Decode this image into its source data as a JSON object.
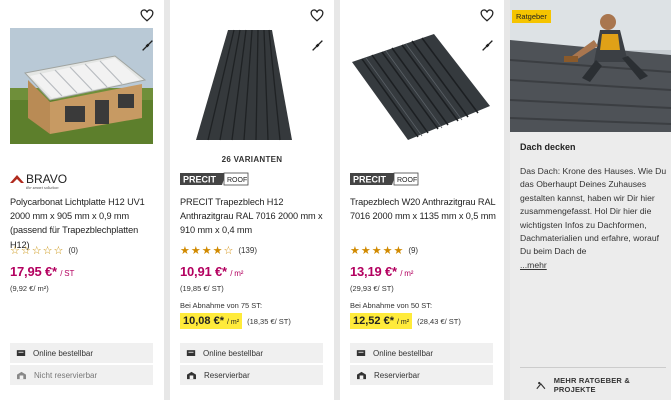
{
  "products": [
    {
      "variants": "",
      "brand": "BRAVO",
      "brand_tagline": "the smart solution",
      "title": "Polycarbonat Lichtplatte H12 UV1 2000 mm x 905 mm x 0,9 mm (passend für Trapezblechplatten H12)",
      "stars": "☆☆☆☆☆",
      "rating_count": "(0)",
      "price": "17,95 €*",
      "price_unit": "/ ST",
      "subprice": "(9,92 €/ m²)",
      "bulk_label": "",
      "bulk_price": "",
      "bulk_unit": "",
      "bulk_subprice": "",
      "availability_online": "Online bestellbar",
      "availability_reserve": "Nicht reservierbar"
    },
    {
      "variants": "26 VARIANTEN",
      "brand": "PRECIT",
      "brand_suffix": "ROOF",
      "title": "PRECIT Trapezblech H12 Anthrazitgrau RAL 7016 2000 mm x 910 mm x 0,4 mm",
      "stars": "★★★★☆",
      "rating_count": "(139)",
      "price": "10,91 €*",
      "price_unit": "/ m²",
      "subprice": "(19,85 €/ ST)",
      "bulk_label": "Bei Abnahme von 75 ST:",
      "bulk_price": "10,08 €*",
      "bulk_unit": "/ m²",
      "bulk_subprice": "(18,35 €/ ST)",
      "availability_online": "Online bestellbar",
      "availability_reserve": "Reservierbar"
    },
    {
      "variants": "",
      "brand": "PRECIT",
      "brand_suffix": "ROOF",
      "title": "Trapezblech W20 Anthrazitgrau RAL 7016 2000 mm x 1135 mm x 0,5 mm",
      "stars": "★★★★★",
      "rating_count": "(9)",
      "price": "13,19 €*",
      "price_unit": "/ m²",
      "subprice": "(29,93 €/ ST)",
      "bulk_label": "Bei Abnahme von 50 ST:",
      "bulk_price": "12,52 €*",
      "bulk_unit": "/ m²",
      "bulk_subprice": "(28,43 €/ ST)",
      "availability_online": "Online bestellbar",
      "availability_reserve": "Reservierbar"
    }
  ],
  "ratgeber": {
    "badge": "Ratgeber",
    "title": "Dach decken",
    "text": "Das Dach: Krone des Hauses. Wie Du das Oberhaupt Deines Zuhauses gestalten kannst, haben wir Dir hier zusammengefasst. Hol Dir hier die wichtigsten Infos zu Dachformen, Dachmaterialien und erfahre, worauf Du beim Dach de",
    "more": "...mehr",
    "link": "MEHR RATGEBER & PROJEKTE"
  },
  "colors": {
    "price": "#b3005f",
    "highlight": "#ffeb3b",
    "badge": "#f5c400",
    "star": "#d18a00"
  },
  "icons": [
    "heart-icon",
    "compare-icon",
    "truck-icon",
    "store-icon",
    "roof-worker-icon"
  ]
}
